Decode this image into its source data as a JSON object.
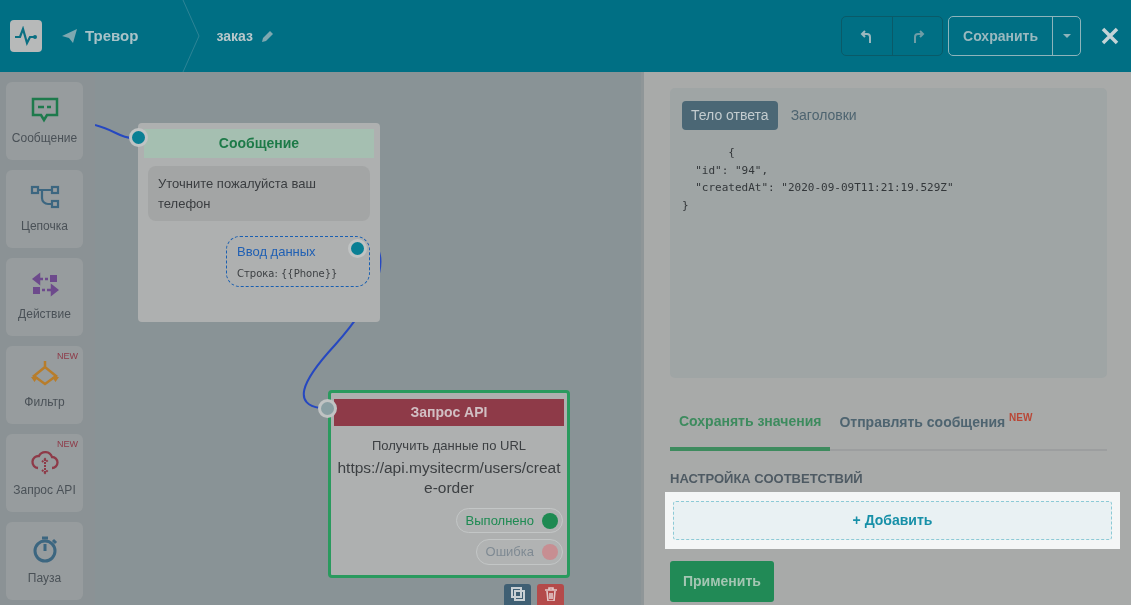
{
  "header": {
    "bot_name": "Тревор",
    "flow_name": "заказ",
    "save_label": "Сохранить"
  },
  "sidebar": {
    "items": [
      {
        "kind": "message",
        "label": "Сообщение"
      },
      {
        "kind": "chain",
        "label": "Цепочка"
      },
      {
        "kind": "action",
        "label": "Действие"
      },
      {
        "kind": "filter",
        "label": "Фильтр",
        "badge": "NEW"
      },
      {
        "kind": "api",
        "label": "Запрос API",
        "badge": "NEW"
      },
      {
        "kind": "pause",
        "label": "Пауза"
      }
    ]
  },
  "canvas": {
    "nodes": [
      {
        "kind": "message",
        "title": "Сообщение",
        "text": "Уточните пожалуйста ваш телефон",
        "input": {
          "title": "Ввод данных",
          "value": "Строка: {{Phone}}"
        }
      },
      {
        "kind": "api",
        "title": "Запрос API",
        "description": "Получить данные по URL",
        "url": "https://api.mysitecrm/users/create-order",
        "selected": true,
        "outputs": [
          {
            "kind": "success",
            "label": "Выполнено"
          },
          {
            "kind": "error",
            "label": "Ошибка"
          }
        ]
      }
    ]
  },
  "response": {
    "tabs": [
      {
        "label": "Тело ответа",
        "selected": true
      },
      {
        "label": "Заголовки",
        "selected": false
      }
    ],
    "body": [
      "       {",
      "  \"id\": \"94\",",
      "  \"createdAt\": \"2020-09-09T11:21:19.529Z\"",
      "}"
    ]
  },
  "settings": {
    "tabs": [
      {
        "label": "Сохранять значения",
        "selected": true
      },
      {
        "label": "Отправлять сообщения",
        "selected": false,
        "badge": "NEW"
      }
    ],
    "section_title": "НАСТРОЙКА СООТВЕТСТВИЙ",
    "add_button": "+ Добавить",
    "apply_button": "Применить"
  }
}
